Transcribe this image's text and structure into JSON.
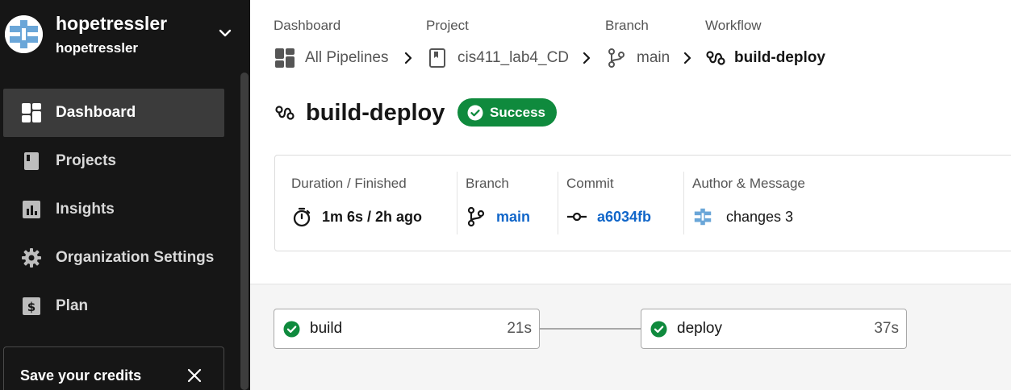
{
  "org": {
    "name": "hopetressler",
    "subtitle": "hopetressler"
  },
  "nav": [
    {
      "label": "Dashboard",
      "icon": "dashboard-icon",
      "active": true
    },
    {
      "label": "Projects",
      "icon": "project-icon",
      "active": false
    },
    {
      "label": "Insights",
      "icon": "insights-icon",
      "active": false
    },
    {
      "label": "Organization Settings",
      "icon": "gear-icon",
      "active": false
    },
    {
      "label": "Plan",
      "icon": "dollar-icon",
      "active": false
    }
  ],
  "credits": {
    "title": "Save your credits"
  },
  "breadcrumb": {
    "dashboard": {
      "heading": "Dashboard",
      "value": "All Pipelines"
    },
    "project": {
      "heading": "Project",
      "value": "cis411_lab4_CD"
    },
    "branch": {
      "heading": "Branch",
      "value": "main"
    },
    "workflow": {
      "heading": "Workflow",
      "value": "build-deploy"
    }
  },
  "workflow": {
    "title": "build-deploy",
    "status": "Success"
  },
  "info": {
    "duration": {
      "label": "Duration / Finished",
      "value": "1m 6s / 2h ago"
    },
    "branch": {
      "label": "Branch",
      "value": "main"
    },
    "commit": {
      "label": "Commit",
      "value": "a6034fb"
    },
    "author": {
      "label": "Author & Message",
      "value": "changes 3"
    }
  },
  "jobs": [
    {
      "name": "build",
      "duration": "21s",
      "status": "success"
    },
    {
      "name": "deploy",
      "duration": "37s",
      "status": "success"
    }
  ],
  "colors": {
    "success": "#0f8a3d",
    "link": "#1166c9",
    "sidebar": "#161616"
  }
}
